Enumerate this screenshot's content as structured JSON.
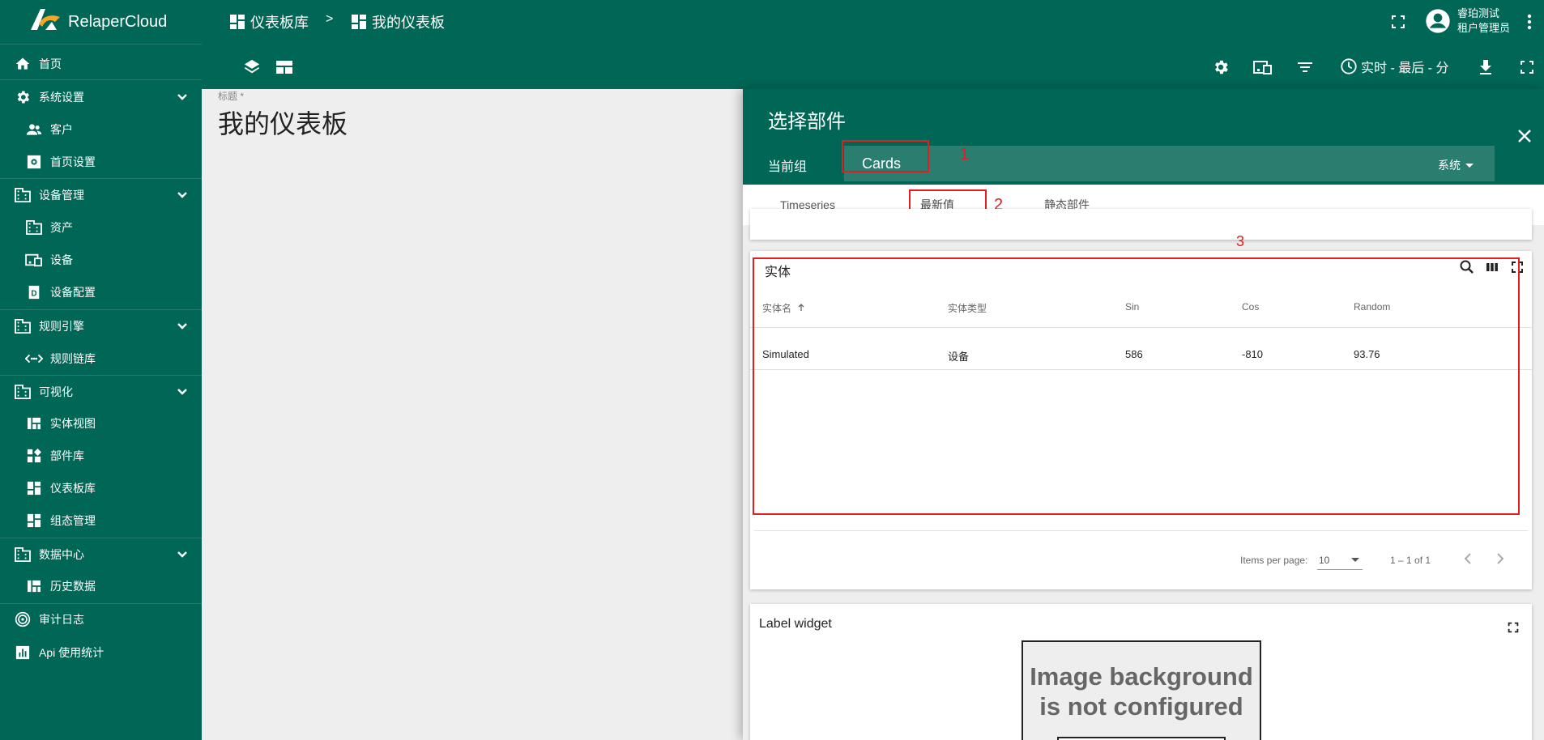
{
  "app": {
    "brand": "RelaperCloud"
  },
  "sidebar": {
    "items": [
      {
        "label": "首页",
        "icon": "home-icon"
      },
      {
        "label": "系统设置",
        "icon": "gear-icon"
      },
      {
        "label": "客户",
        "icon": "users-icon"
      },
      {
        "label": "首页设置",
        "icon": "gear-box-icon"
      },
      {
        "label": "设备管理",
        "icon": "building-icon"
      },
      {
        "label": "资产",
        "icon": "building-icon"
      },
      {
        "label": "设备",
        "icon": "device-icon"
      },
      {
        "label": "设备配置",
        "icon": "device-profile-icon"
      },
      {
        "label": "规则引擎",
        "icon": "building-icon"
      },
      {
        "label": "规则链库",
        "icon": "rule-chain-icon"
      },
      {
        "label": "可视化",
        "icon": "building-icon"
      },
      {
        "label": "实体视图",
        "icon": "entity-view-icon"
      },
      {
        "label": "部件库",
        "icon": "widgets-icon"
      },
      {
        "label": "仪表板库",
        "icon": "dashboard-icon"
      },
      {
        "label": "组态管理",
        "icon": "dashboard-icon"
      },
      {
        "label": "数据中心",
        "icon": "building-icon"
      },
      {
        "label": "历史数据",
        "icon": "entity-view-icon"
      },
      {
        "label": "审计日志",
        "icon": "audit-icon"
      },
      {
        "label": "Api 使用统计",
        "icon": "chart-icon"
      }
    ]
  },
  "header": {
    "breadcrumb_1": "仪表板库",
    "breadcrumb_sep": ">",
    "breadcrumb_2": "我的仪表板",
    "user_name": "睿珀测试",
    "user_role": "租户管理员",
    "time_window": "实时 - 最后 - 分"
  },
  "dashboard": {
    "title_label": "标题 *",
    "title": "我的仪表板"
  },
  "panel": {
    "title": "选择部件",
    "group_label": "当前组",
    "group_value": "Cards",
    "group_scope": "系统",
    "tabs": [
      "Timeseries",
      "最新值",
      "静态部件"
    ],
    "annotations": [
      "1",
      "2",
      "3"
    ]
  },
  "entity_widget": {
    "title": "实体",
    "columns": [
      "实体名",
      "实体类型",
      "Sin",
      "Cos",
      "Random"
    ],
    "rows": [
      [
        "Simulated",
        "设备",
        "586",
        "-810",
        "93.76"
      ]
    ],
    "items_per_page_label": "Items per page:",
    "items_per_page": "10",
    "range": "1 – 1 of 1"
  },
  "label_widget": {
    "title": "Label widget",
    "image_text_1": "Image background",
    "image_text_2": "is not configured"
  },
  "colors": {
    "primary": "#006655",
    "annotation": "#e02020"
  }
}
